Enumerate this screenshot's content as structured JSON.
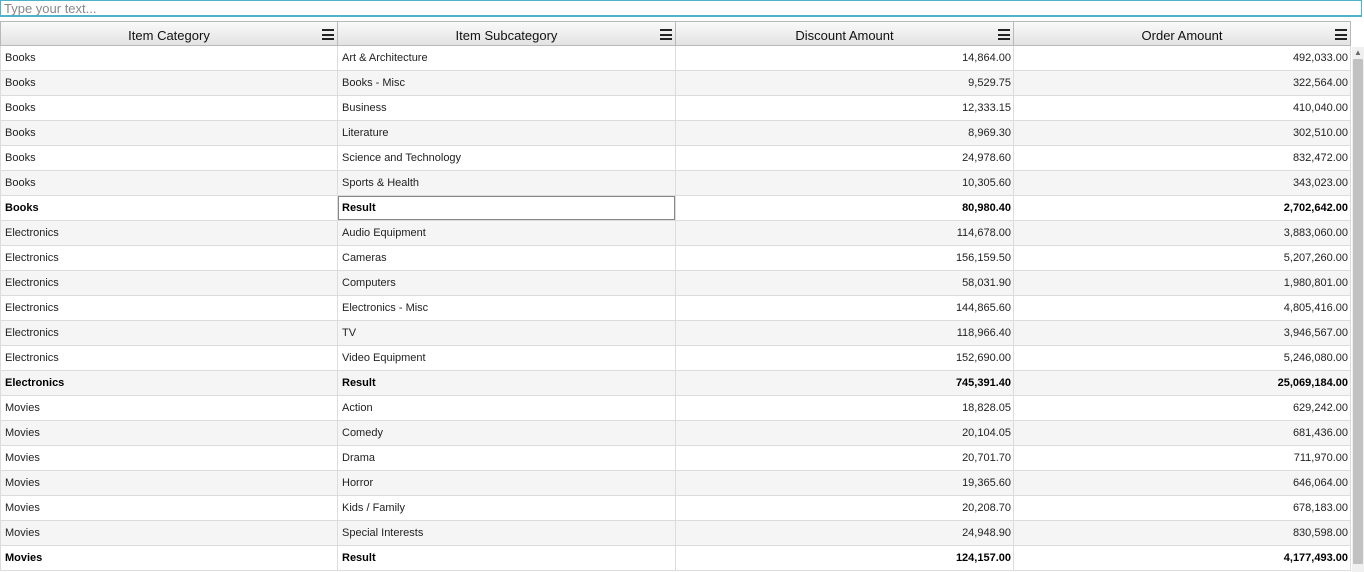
{
  "search": {
    "placeholder": "Type your text..."
  },
  "columns": [
    "Item Category",
    "Item Subcategory",
    "Discount Amount",
    "Order Amount"
  ],
  "rows": [
    {
      "category": "Books",
      "subcategory": "Art & Architecture",
      "discount": "14,864.00",
      "order": "492,033.00",
      "total": false
    },
    {
      "category": "Books",
      "subcategory": "Books - Misc",
      "discount": "9,529.75",
      "order": "322,564.00",
      "total": false
    },
    {
      "category": "Books",
      "subcategory": "Business",
      "discount": "12,333.15",
      "order": "410,040.00",
      "total": false
    },
    {
      "category": "Books",
      "subcategory": "Literature",
      "discount": "8,969.30",
      "order": "302,510.00",
      "total": false
    },
    {
      "category": "Books",
      "subcategory": "Science and Technology",
      "discount": "24,978.60",
      "order": "832,472.00",
      "total": false
    },
    {
      "category": "Books",
      "subcategory": "Sports & Health",
      "discount": "10,305.60",
      "order": "343,023.00",
      "total": false
    },
    {
      "category": "Books",
      "subcategory": "Result",
      "discount": "80,980.40",
      "order": "2,702,642.00",
      "total": true,
      "selected": true
    },
    {
      "category": "Electronics",
      "subcategory": "Audio Equipment",
      "discount": "114,678.00",
      "order": "3,883,060.00",
      "total": false
    },
    {
      "category": "Electronics",
      "subcategory": "Cameras",
      "discount": "156,159.50",
      "order": "5,207,260.00",
      "total": false
    },
    {
      "category": "Electronics",
      "subcategory": "Computers",
      "discount": "58,031.90",
      "order": "1,980,801.00",
      "total": false
    },
    {
      "category": "Electronics",
      "subcategory": "Electronics - Misc",
      "discount": "144,865.60",
      "order": "4,805,416.00",
      "total": false
    },
    {
      "category": "Electronics",
      "subcategory": "TV",
      "discount": "118,966.40",
      "order": "3,946,567.00",
      "total": false
    },
    {
      "category": "Electronics",
      "subcategory": "Video Equipment",
      "discount": "152,690.00",
      "order": "5,246,080.00",
      "total": false
    },
    {
      "category": "Electronics",
      "subcategory": "Result",
      "discount": "745,391.40",
      "order": "25,069,184.00",
      "total": true
    },
    {
      "category": "Movies",
      "subcategory": "Action",
      "discount": "18,828.05",
      "order": "629,242.00",
      "total": false
    },
    {
      "category": "Movies",
      "subcategory": "Comedy",
      "discount": "20,104.05",
      "order": "681,436.00",
      "total": false
    },
    {
      "category": "Movies",
      "subcategory": "Drama",
      "discount": "20,701.70",
      "order": "711,970.00",
      "total": false
    },
    {
      "category": "Movies",
      "subcategory": "Horror",
      "discount": "19,365.60",
      "order": "646,064.00",
      "total": false
    },
    {
      "category": "Movies",
      "subcategory": "Kids / Family",
      "discount": "20,208.70",
      "order": "678,183.00",
      "total": false
    },
    {
      "category": "Movies",
      "subcategory": "Special Interests",
      "discount": "24,948.90",
      "order": "830,598.00",
      "total": false
    },
    {
      "category": "Movies",
      "subcategory": "Result",
      "discount": "124,157.00",
      "order": "4,177,493.00",
      "total": true
    }
  ],
  "icons": {
    "column_menu": "hamburger-menu-icon",
    "scroll_up": "scroll-up-arrow-icon"
  }
}
